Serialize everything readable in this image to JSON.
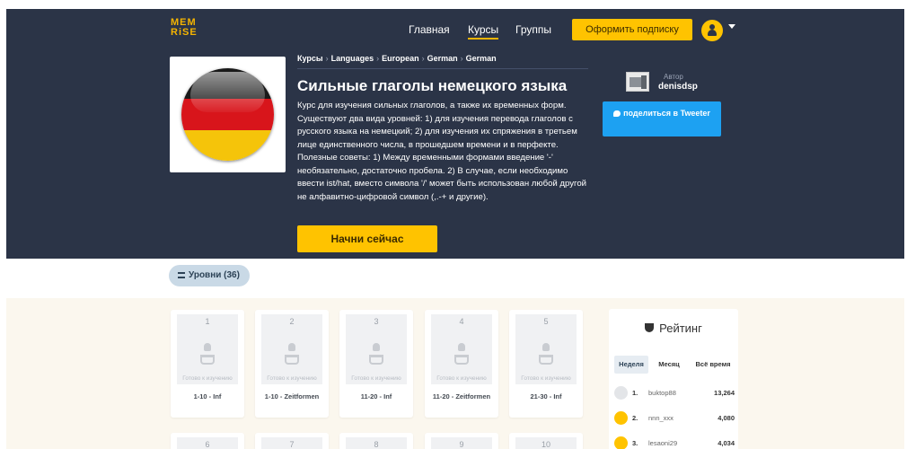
{
  "header": {
    "logo": "MEM\nRiSE",
    "nav": [
      "Главная",
      "Курсы",
      "Группы"
    ],
    "subscribe_label": "Оформить подписку"
  },
  "course": {
    "breadcrumbs": [
      "Курсы",
      "Languages",
      "European",
      "German",
      "German"
    ],
    "title": "Сильные глаголы немецкого языка",
    "description": "Курс для изучения сильных глаголов, а также их временных форм. Существуют два вида уровней: 1) для изучения перевода глаголов с русского языка на немецкий; 2) для изучения их спряжения в третьем лице единственного числа, в прошедшем времени и в перфекте. Полезные советы: 1) Между временными формами введение '-' необязательно, достаточно пробела. 2) В случае, если необходимо ввести ist/hat, вместо символа '/' может быть использован любой другой не алфавитно-цифровой символ (,.-+ и другие).",
    "start_label": "Начни сейчас"
  },
  "author": {
    "caption": "Автор",
    "name": "denisdsp",
    "share_label": "поделиться в Tweeter"
  },
  "levels": {
    "tab_label": "Уровни (36)",
    "status_text": "Готово к изучению",
    "items": [
      {
        "num": "1",
        "label": "1-10 - Inf"
      },
      {
        "num": "2",
        "label": "1-10 - Zeitformen"
      },
      {
        "num": "3",
        "label": "11-20 - Inf"
      },
      {
        "num": "4",
        "label": "11-20 - Zeitformen"
      },
      {
        "num": "5",
        "label": "21-30 - Inf"
      },
      {
        "num": "6"
      },
      {
        "num": "7"
      },
      {
        "num": "8"
      },
      {
        "num": "9"
      },
      {
        "num": "10"
      }
    ]
  },
  "rating": {
    "title": "Рейтинг",
    "tabs": [
      "Неделя",
      "Месяц",
      "Всё время"
    ],
    "rows": [
      {
        "rank": "1.",
        "user": "buktop88",
        "score": "13,264"
      },
      {
        "rank": "2.",
        "user": "nnn_xxx",
        "score": "4,080"
      },
      {
        "rank": "3.",
        "user": "lesaoni29",
        "score": "4,034"
      }
    ]
  },
  "colors": {
    "hero_bg": "#2b3447",
    "accent": "#ffc300",
    "twitter": "#1da1f2",
    "content_bg": "#fbf7ee"
  }
}
